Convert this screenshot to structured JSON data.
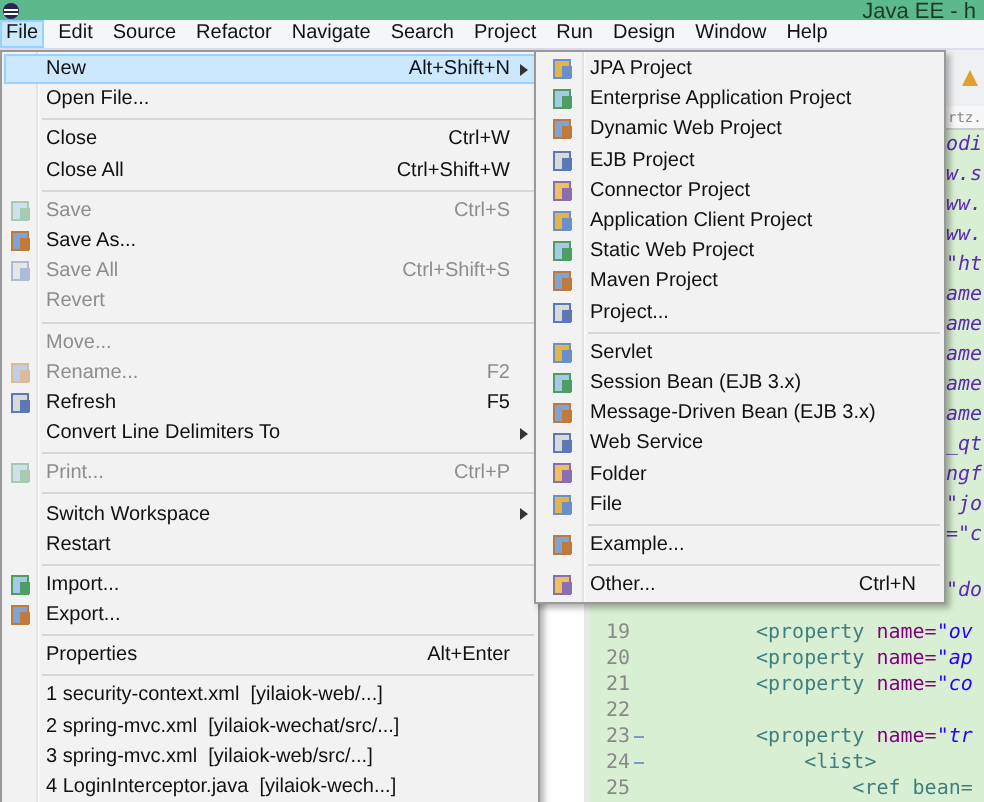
{
  "window": {
    "title": "Java EE - h"
  },
  "menubar": [
    {
      "label": "File",
      "selected": true
    },
    {
      "label": "Edit",
      "selected": false
    },
    {
      "label": "Source",
      "selected": false
    },
    {
      "label": "Refactor",
      "selected": false
    },
    {
      "label": "Navigate",
      "selected": false
    },
    {
      "label": "Search",
      "selected": false
    },
    {
      "label": "Project",
      "selected": false
    },
    {
      "label": "Run",
      "selected": false
    },
    {
      "label": "Design",
      "selected": false
    },
    {
      "label": "Window",
      "selected": false
    },
    {
      "label": "Help",
      "selected": false
    }
  ],
  "file_menu": [
    {
      "kind": "item",
      "label": "New",
      "shortcut": "Alt+Shift+N",
      "submenu": true,
      "disabled": false,
      "selected": true,
      "has_icon": false
    },
    {
      "kind": "item",
      "label": "Open File...",
      "submenu": false,
      "disabled": false,
      "selected": false,
      "has_icon": false
    },
    {
      "kind": "separator"
    },
    {
      "kind": "item",
      "label": "Close",
      "shortcut": "Ctrl+W",
      "submenu": false,
      "disabled": false,
      "selected": false,
      "has_icon": false
    },
    {
      "kind": "item",
      "label": "Close All",
      "shortcut": "Ctrl+Shift+W",
      "submenu": false,
      "disabled": false,
      "selected": false,
      "has_icon": false
    },
    {
      "kind": "separator"
    },
    {
      "kind": "item",
      "label": "Save",
      "shortcut": "Ctrl+S",
      "submenu": false,
      "disabled": true,
      "selected": false,
      "has_icon": true
    },
    {
      "kind": "item",
      "label": "Save As...",
      "submenu": false,
      "disabled": false,
      "selected": false,
      "has_icon": true
    },
    {
      "kind": "item",
      "label": "Save All",
      "shortcut": "Ctrl+Shift+S",
      "submenu": false,
      "disabled": true,
      "selected": false,
      "has_icon": true
    },
    {
      "kind": "item",
      "label": "Revert",
      "submenu": false,
      "disabled": true,
      "selected": false,
      "has_icon": false
    },
    {
      "kind": "separator"
    },
    {
      "kind": "item",
      "label": "Move...",
      "submenu": false,
      "disabled": true,
      "selected": false,
      "has_icon": false
    },
    {
      "kind": "item",
      "label": "Rename...",
      "shortcut": "F2",
      "submenu": false,
      "disabled": true,
      "selected": false,
      "has_icon": true
    },
    {
      "kind": "item",
      "label": "Refresh",
      "shortcut": "F5",
      "submenu": false,
      "disabled": false,
      "selected": false,
      "has_icon": true
    },
    {
      "kind": "item",
      "label": "Convert Line Delimiters To",
      "submenu": true,
      "disabled": false,
      "selected": false,
      "has_icon": false
    },
    {
      "kind": "separator"
    },
    {
      "kind": "item",
      "label": "Print...",
      "shortcut": "Ctrl+P",
      "submenu": false,
      "disabled": true,
      "selected": false,
      "has_icon": true
    },
    {
      "kind": "separator"
    },
    {
      "kind": "item",
      "label": "Switch Workspace",
      "submenu": true,
      "disabled": false,
      "selected": false,
      "has_icon": false
    },
    {
      "kind": "item",
      "label": "Restart",
      "submenu": false,
      "disabled": false,
      "selected": false,
      "has_icon": false
    },
    {
      "kind": "separator"
    },
    {
      "kind": "item",
      "label": "Import...",
      "submenu": false,
      "disabled": false,
      "selected": false,
      "has_icon": true
    },
    {
      "kind": "item",
      "label": "Export...",
      "submenu": false,
      "disabled": false,
      "selected": false,
      "has_icon": true
    },
    {
      "kind": "separator"
    },
    {
      "kind": "item",
      "label": "Properties",
      "shortcut": "Alt+Enter",
      "submenu": false,
      "disabled": false,
      "selected": false,
      "has_icon": false
    },
    {
      "kind": "separator"
    },
    {
      "kind": "item",
      "label": "1 security-context.xml  [yilaiok-web/...]",
      "submenu": false,
      "disabled": false,
      "selected": false,
      "has_icon": false
    },
    {
      "kind": "item",
      "label": "2 spring-mvc.xml  [yilaiok-wechat/src/...]",
      "submenu": false,
      "disabled": false,
      "selected": false,
      "has_icon": false
    },
    {
      "kind": "item",
      "label": "3 spring-mvc.xml  [yilaiok-web/src/...]",
      "submenu": false,
      "disabled": false,
      "selected": false,
      "has_icon": false
    },
    {
      "kind": "item",
      "label": "4 LoginInterceptor.java  [yilaiok-wech...]",
      "submenu": false,
      "disabled": false,
      "selected": false,
      "has_icon": false
    }
  ],
  "new_submenu": [
    {
      "kind": "item",
      "label": "JPA Project"
    },
    {
      "kind": "item",
      "label": "Enterprise Application Project"
    },
    {
      "kind": "item",
      "label": "Dynamic Web Project"
    },
    {
      "kind": "item",
      "label": "EJB Project"
    },
    {
      "kind": "item",
      "label": "Connector Project"
    },
    {
      "kind": "item",
      "label": "Application Client Project"
    },
    {
      "kind": "item",
      "label": "Static Web Project"
    },
    {
      "kind": "item",
      "label": "Maven Project"
    },
    {
      "kind": "item",
      "label": "Project..."
    },
    {
      "kind": "separator"
    },
    {
      "kind": "item",
      "label": "Servlet"
    },
    {
      "kind": "item",
      "label": "Session Bean (EJB 3.x)"
    },
    {
      "kind": "item",
      "label": "Message-Driven Bean (EJB 3.x)"
    },
    {
      "kind": "item",
      "label": "Web Service"
    },
    {
      "kind": "item",
      "label": "Folder"
    },
    {
      "kind": "item",
      "label": "File"
    },
    {
      "kind": "separator"
    },
    {
      "kind": "item",
      "label": "Example..."
    },
    {
      "kind": "separator"
    },
    {
      "kind": "item",
      "label": "Other...",
      "shortcut": "Ctrl+N"
    }
  ],
  "editor": {
    "tab": "rtz.",
    "fragments": [
      "odi",
      "w.s",
      "ww.",
      "ww.",
      "\"ht",
      "ame",
      "ame",
      "ame",
      "ame",
      "ame",
      "_qt",
      "ngf",
      "\"jo",
      "=\"c"
    ],
    "partial_line": "\"do",
    "lines": [
      {
        "number": "19",
        "code": "<property name=\"ov",
        "foldable": false
      },
      {
        "number": "20",
        "code": "<property name=\"ap",
        "foldable": false
      },
      {
        "number": "21",
        "code": "<property name=\"co",
        "foldable": false
      },
      {
        "number": "22",
        "foldable": false
      },
      {
        "number": "23",
        "code": "<property name=\"tr",
        "foldable": true
      },
      {
        "number": "24",
        "code": "    <list>",
        "foldable": true
      },
      {
        "number": "25",
        "code": "        <ref bean=",
        "foldable": false
      }
    ]
  }
}
